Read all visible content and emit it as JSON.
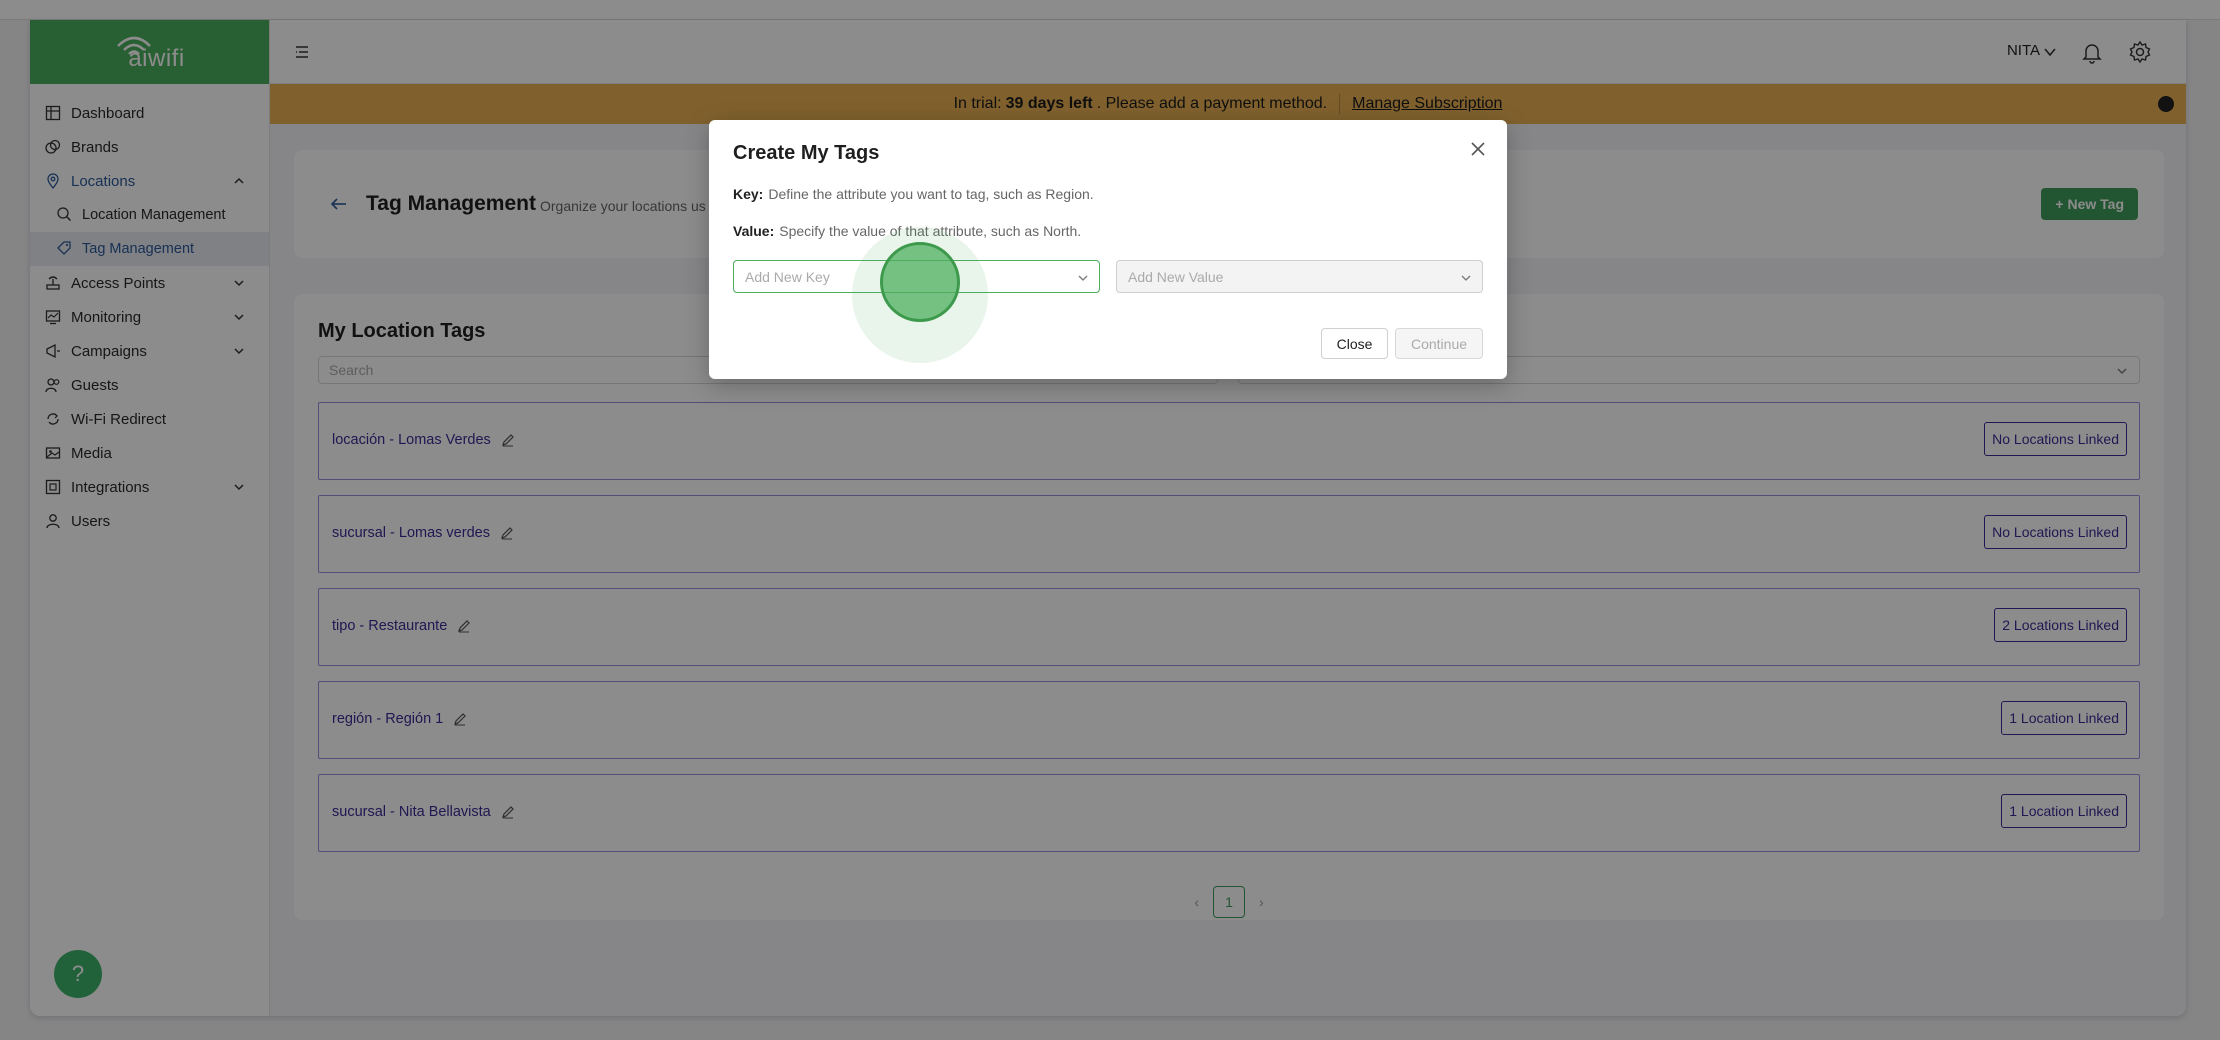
{
  "app": {
    "logo_text": "aiwifi"
  },
  "sidebar": {
    "items": [
      {
        "label": "Dashboard"
      },
      {
        "label": "Brands"
      },
      {
        "label": "Locations"
      },
      {
        "label": "Location Management"
      },
      {
        "label": "Tag Management"
      },
      {
        "label": "Access Points"
      },
      {
        "label": "Monitoring"
      },
      {
        "label": "Campaigns"
      },
      {
        "label": "Guests"
      },
      {
        "label": "Wi-Fi Redirect"
      },
      {
        "label": "Media"
      },
      {
        "label": "Integrations"
      },
      {
        "label": "Users"
      }
    ],
    "help_label": "?"
  },
  "header": {
    "user_name": "NITA"
  },
  "banner": {
    "prefix": "In trial:",
    "days": "39 days left",
    "suffix": ". Please add a payment method.",
    "manage": "Manage Subscription"
  },
  "page": {
    "title": "Tag Management",
    "subtitle": "Organize your locations us",
    "new_tag": "+ New Tag",
    "section_title": "My Location Tags",
    "search_placeholder": "Search",
    "tags": [
      {
        "label": "locación - Lomas Verdes",
        "linked": "No Locations Linked"
      },
      {
        "label": "sucursal - Lomas verdes",
        "linked": "No Locations Linked"
      },
      {
        "label": "tipo - Restaurante",
        "linked": "2 Locations Linked"
      },
      {
        "label": "región - Región 1",
        "linked": "1 Location Linked"
      },
      {
        "label": "sucursal - Nita Bellavista",
        "linked": "1 Location Linked"
      }
    ],
    "pagination": {
      "prev": "‹",
      "current": "1",
      "next": "›"
    }
  },
  "modal": {
    "title": "Create My Tags",
    "key_label": "Key:",
    "key_desc": "Define the attribute you want to tag, such as Region.",
    "value_label": "Value:",
    "value_desc": "Specify the value of that attribute, such as North.",
    "key_placeholder": "Add New Key",
    "value_placeholder": "Add New Value",
    "close_label": "Close",
    "continue_label": "Continue"
  },
  "colors": {
    "brand": "#4caf5d",
    "banner": "#eab155",
    "tag_text": "#3b2c95"
  }
}
